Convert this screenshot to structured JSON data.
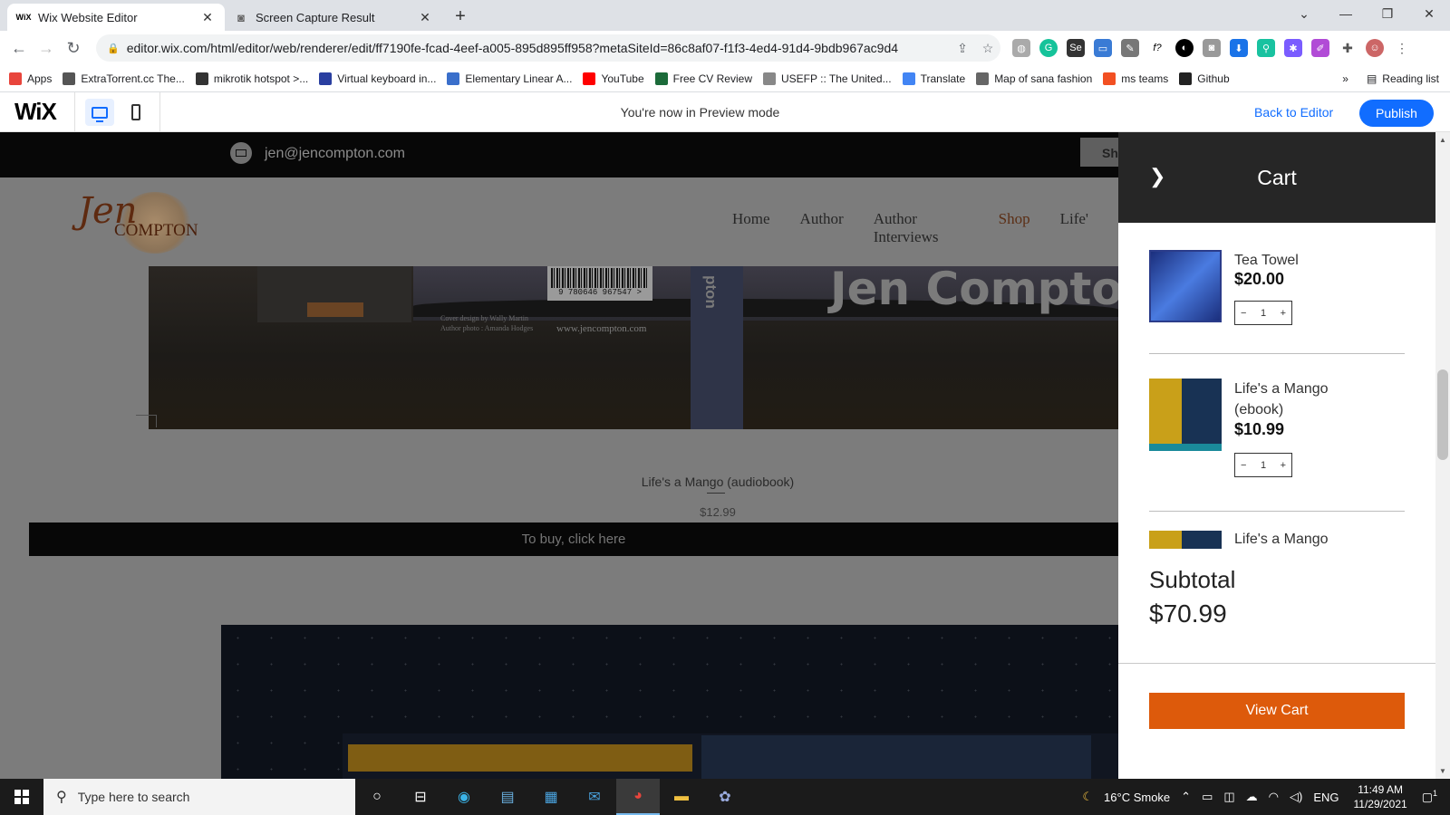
{
  "browser": {
    "tabs": [
      {
        "title": "Wix Website Editor",
        "favicon": "WiX",
        "active": true
      },
      {
        "title": "Screen Capture Result",
        "favicon": "camera-icon",
        "active": false
      }
    ],
    "url": "editor.wix.com/html/editor/web/renderer/edit/ff7190fe-fcad-4eef-a005-895d895ff958?metaSiteId=86c8af07-f1f3-4ed4-91d4-9bdb967ac9d4",
    "bookmarks": [
      {
        "label": "Apps",
        "color": "#e8453c"
      },
      {
        "label": "ExtraTorrent.cc The...",
        "color": "#555555"
      },
      {
        "label": "mikrotik hotspot >...",
        "color": "#333333"
      },
      {
        "label": "Virtual keyboard in...",
        "color": "#2a3fa0"
      },
      {
        "label": "Elementary Linear A...",
        "color": "#3a6fcb"
      },
      {
        "label": "YouTube",
        "color": "#ff0000"
      },
      {
        "label": "Free CV Review",
        "color": "#1c6b3a"
      },
      {
        "label": "USEFP :: The United...",
        "color": "#888888"
      },
      {
        "label": "Translate",
        "color": "#4285f4"
      },
      {
        "label": "Map of sana fashion",
        "color": "#666666"
      },
      {
        "label": "ms teams",
        "color": "#f25022"
      },
      {
        "label": "Github",
        "color": "#222222"
      }
    ],
    "bookmarks_more": "»",
    "reading_list": "Reading list"
  },
  "wix": {
    "logo": "WiX",
    "preview_message": "You're now in Preview mode",
    "back_to_editor": "Back to Editor",
    "publish": "Publish"
  },
  "site": {
    "email": "jen@jencompton.com",
    "shop_btn": "Sh",
    "logo_script": "Jen",
    "logo_text": "COMPTON",
    "nav": [
      "Home",
      "Author",
      "Author Interviews",
      "Shop",
      "Life'"
    ],
    "cover": {
      "barcode_number": "9 780646 967547 >",
      "credits_line1": "Cover design by Wally Martin",
      "credits_line2": "Author photo : Amanda Hodges",
      "website": "www.jencompton.com",
      "spine_text": "pton",
      "name": "Jen Compton"
    },
    "product_title": "Life's a Mango (audiobook)",
    "product_price": "$12.99",
    "buy_button": "To buy, click here"
  },
  "cart": {
    "title": "Cart",
    "items": [
      {
        "name": "Tea Towel",
        "price": "$20.00",
        "qty": "1"
      },
      {
        "name": "Life's a Mango (ebook)",
        "price": "$10.99",
        "qty": "1"
      },
      {
        "name": "Life's a Mango",
        "price": "",
        "qty": ""
      }
    ],
    "subtotal_label": "Subtotal",
    "subtotal_value": "$70.99",
    "view_cart": "View Cart"
  },
  "taskbar": {
    "search_placeholder": "Type here to search",
    "weather": "16°C  Smoke",
    "language": "ENG",
    "time": "11:49 AM",
    "date": "11/29/2021",
    "notification_count": "1"
  }
}
